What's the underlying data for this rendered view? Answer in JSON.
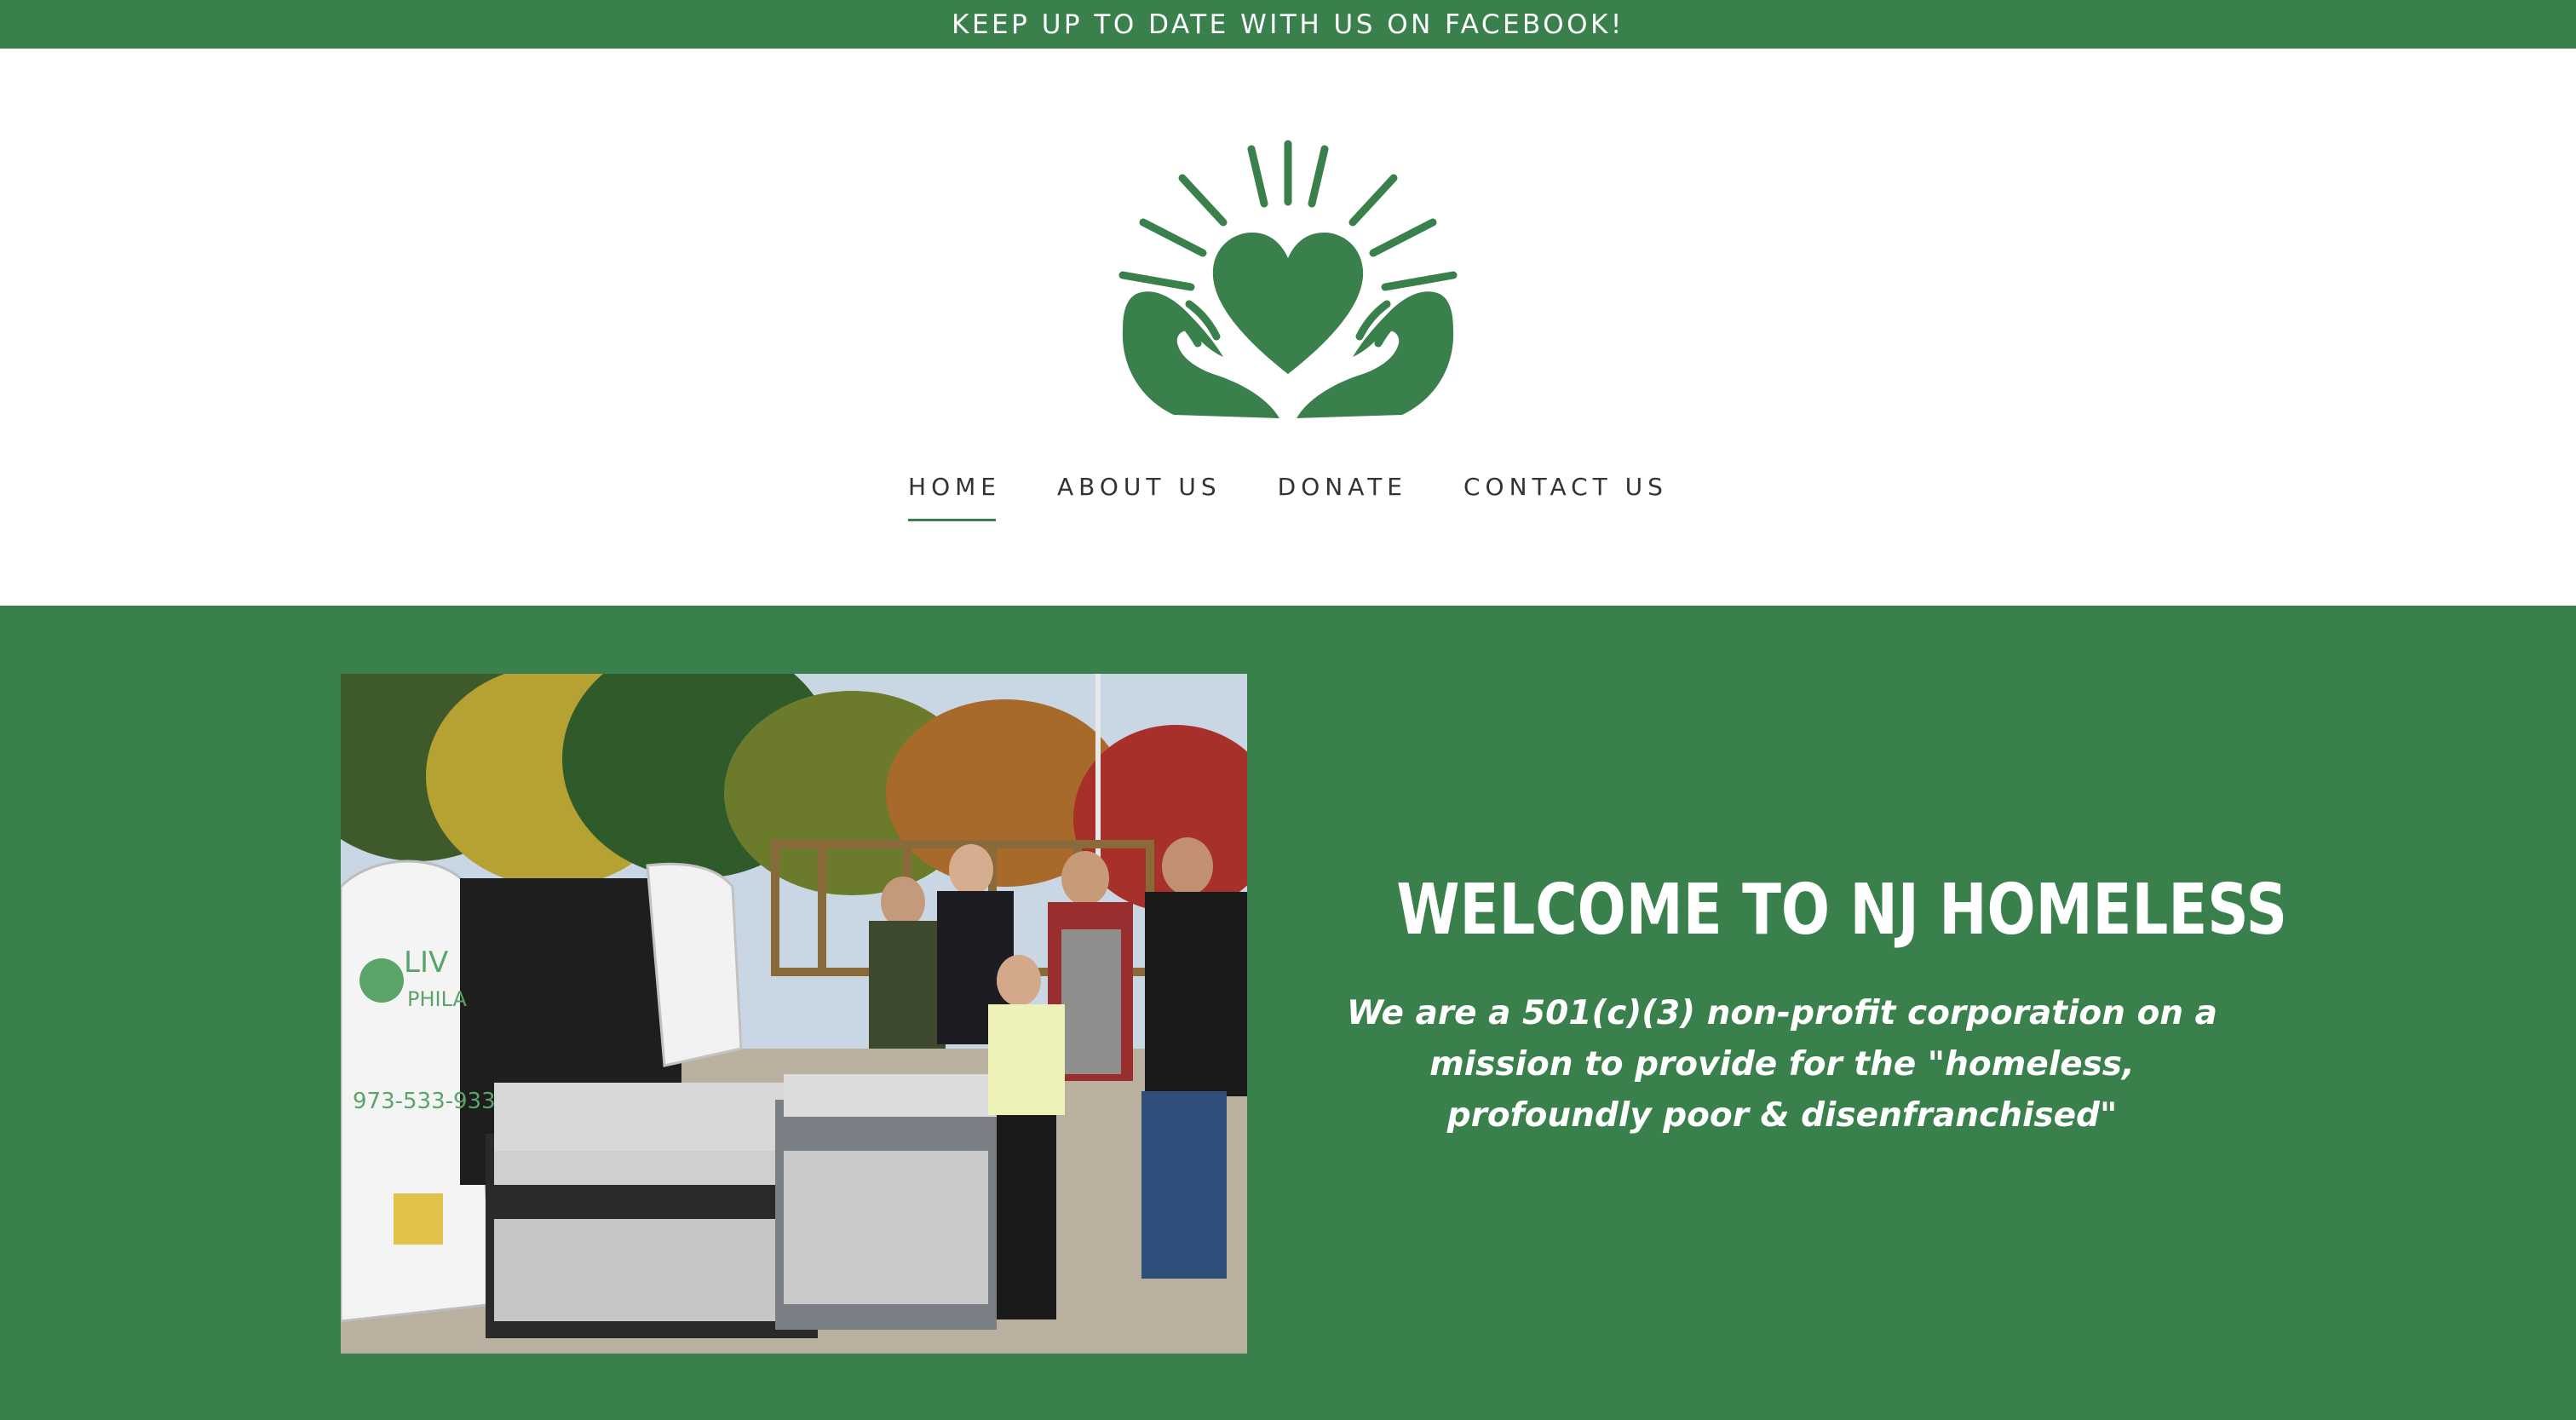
{
  "announcement": {
    "text": "KEEP UP TO DATE WITH US ON FACEBOOK!"
  },
  "colors": {
    "brand_green": "#3a804c",
    "header_bg": "#ffffff",
    "nav_text": "#333333",
    "hero_text": "#ffffff"
  },
  "logo": {
    "icon": "heart-in-hands-sunburst-icon"
  },
  "nav": {
    "items": [
      {
        "label": "HOME",
        "active": true
      },
      {
        "label": "ABOUT US",
        "active": false
      },
      {
        "label": "DONATE",
        "active": false
      },
      {
        "label": "CONTACT US",
        "active": false
      }
    ]
  },
  "hero": {
    "title": "WELCOME TO NJ HOMELESS",
    "subtitle": "We are a 501(c)(3) non-profit corporation on a mission to provide for the  \"homeless, profoundly poor & disenfranchised\"",
    "photo": {
      "van_text": "LIV",
      "van_text_2": "PHILA",
      "van_phone": "973-533-9336"
    }
  }
}
